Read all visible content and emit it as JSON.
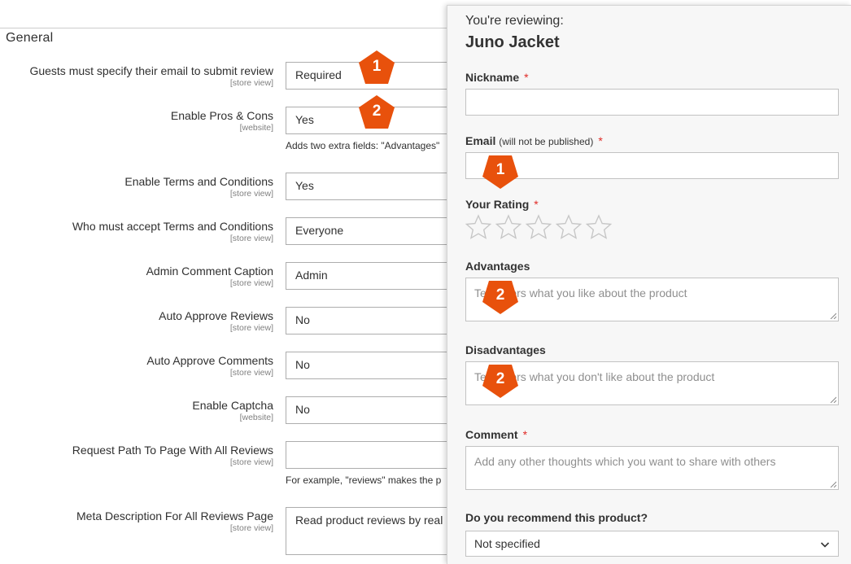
{
  "admin": {
    "section_title": "General",
    "rows": [
      {
        "label": "Guests must specify their email to submit review",
        "scope": "[store view]",
        "value": "Required"
      },
      {
        "label": "Enable Pros & Cons",
        "scope": "[website]",
        "value": "Yes",
        "note": "Adds two extra fields: \"Advantages\""
      },
      {
        "label": "Enable Terms and Conditions",
        "scope": "[store view]",
        "value": "Yes"
      },
      {
        "label": "Who must accept Terms and Conditions",
        "scope": "[store view]",
        "value": "Everyone"
      },
      {
        "label": "Admin Comment Caption",
        "scope": "[store view]",
        "value": "Admin"
      },
      {
        "label": "Auto Approve Reviews",
        "scope": "[store view]",
        "value": "No"
      },
      {
        "label": "Auto Approve Comments",
        "scope": "[store view]",
        "value": "No"
      },
      {
        "label": "Enable Captcha",
        "scope": "[website]",
        "value": "No"
      },
      {
        "label": "Request Path To Page With All Reviews",
        "scope": "[store view]",
        "value": "",
        "note": "For example, \"reviews\" makes the p"
      },
      {
        "label": "Meta Description For All Reviews Page",
        "scope": "[store view]",
        "value": "Read product reviews by real"
      }
    ]
  },
  "review": {
    "reviewing_label": "You're reviewing:",
    "product_name": "Juno Jacket",
    "required_mark": "*",
    "nickname_label": "Nickname",
    "email_label": "Email",
    "email_hint": "(will not be published)",
    "rating_label": "Your Rating",
    "advantages_label": "Advantages",
    "advantages_placeholder": "Tell others what you like about the product",
    "disadvantages_label": "Disadvantages",
    "disadvantages_placeholder": "Tell others what you don't like about the product",
    "comment_label": "Comment",
    "comment_placeholder": "Add any other thoughts which you want to share with others",
    "recommend_label": "Do you recommend this product?",
    "recommend_value": "Not specified",
    "rating_stars": 5
  },
  "markers": [
    "1",
    "2",
    "1",
    "2",
    "2"
  ],
  "colors": {
    "marker": "#e8510c",
    "required": "#e02b27",
    "panel_bg": "#f7f7f7"
  }
}
